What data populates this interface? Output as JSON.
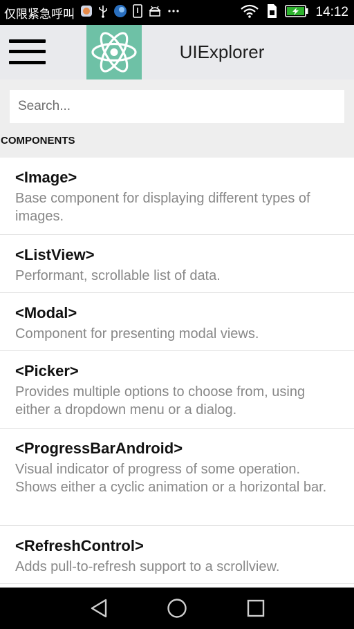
{
  "status_bar": {
    "carrier": "仅限紧急呼叫",
    "time": "14:12",
    "icons": [
      "app-notification-icon",
      "usb-icon",
      "app-notification-icon",
      "download-icon",
      "android-debug-icon",
      "more-icon",
      "wifi-icon",
      "sim-icon",
      "battery-charging-icon"
    ]
  },
  "toolbar": {
    "title": "UIExplorer",
    "menu_icon": "hamburger-menu-icon",
    "logo_icon": "react-atom-icon",
    "logo_color": "#6ec1a6",
    "background": "#e9eaed"
  },
  "search": {
    "placeholder": "Search..."
  },
  "section": {
    "header": "COMPONENTS"
  },
  "components": [
    {
      "title": "<Image>",
      "description": "Base component for displaying different types of images."
    },
    {
      "title": "<ListView>",
      "description": "Performant, scrollable list of data."
    },
    {
      "title": "<Modal>",
      "description": "Component for presenting modal views."
    },
    {
      "title": "<Picker>",
      "description": "Provides multiple options to choose from, using either a dropdown menu or a dialog."
    },
    {
      "title": "<ProgressBarAndroid>",
      "description": "Visual indicator of progress of some operation. Shows either a cyclic animation or a horizontal bar."
    },
    {
      "title": "<RefreshControl>",
      "description": "Adds pull-to-refresh support to a scrollview."
    }
  ],
  "nav_bar": {
    "icons": [
      "back-icon",
      "home-icon",
      "recents-icon"
    ]
  }
}
